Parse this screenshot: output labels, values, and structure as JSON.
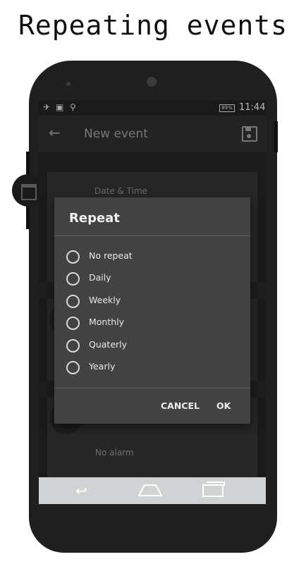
{
  "caption": "Repeating events",
  "status_bar": {
    "icons": [
      "airplane-icon",
      "image-icon",
      "usb-icon"
    ],
    "battery": "89%",
    "time": "11:44"
  },
  "app_bar": {
    "title": "New event",
    "back_icon": "arrow-left-icon",
    "save_icon": "floppy-disk-icon"
  },
  "background": {
    "date_label": "Date & Time",
    "alarm_label": "No alarm"
  },
  "dialog": {
    "title": "Repeat",
    "options": [
      "No repeat",
      "Daily",
      "Weekly",
      "Monthly",
      "Quaterly",
      "Yearly"
    ],
    "cancel": "CANCEL",
    "ok": "OK"
  },
  "nav_bar": {
    "icons": [
      "back-nav-icon",
      "home-nav-icon",
      "recent-apps-icon"
    ]
  },
  "colors": {
    "dialog_bg": "#424242",
    "screen_bg": "#1a1a1a",
    "nav_bg": "#cfd3d3"
  }
}
